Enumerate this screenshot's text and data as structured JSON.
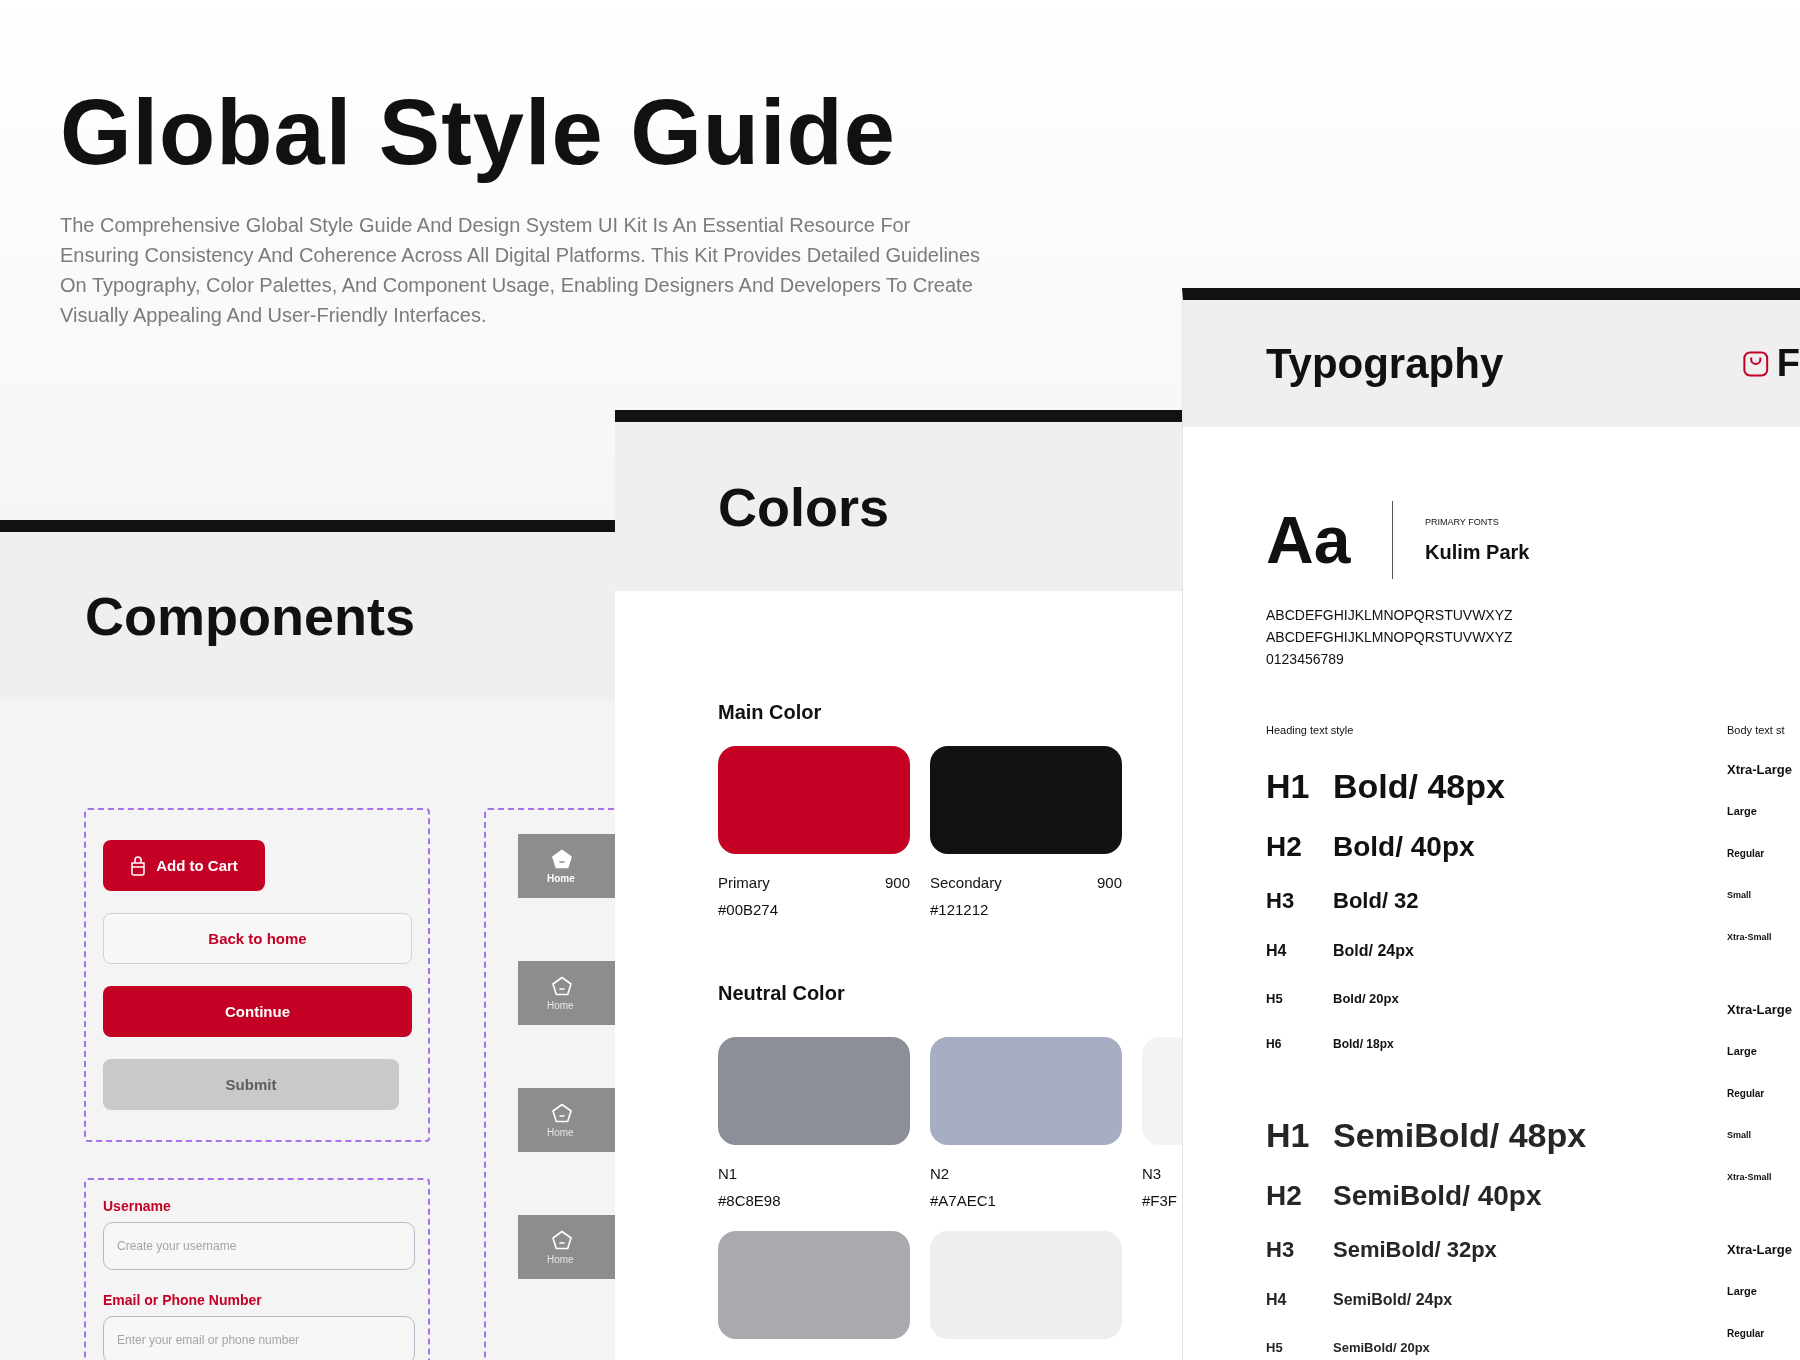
{
  "title": "Global Style Guide",
  "description": "The Comprehensive Global Style Guide And Design System UI Kit Is An Essential Resource For Ensuring Consistency And Coherence Across All Digital Platforms. This Kit Provides Detailed Guidelines On Typography, Color Palettes, And Component Usage, Enabling Designers And Developers To Create Visually Appealing And User-Friendly Interfaces.",
  "components": {
    "title": "Components",
    "buttons": [
      {
        "label": "Add to Cart",
        "kind": "icon-primary"
      },
      {
        "label": "Back to home",
        "kind": "outline"
      },
      {
        "label": "Continue",
        "kind": "primary"
      },
      {
        "label": "Submit",
        "kind": "disabled"
      }
    ],
    "fields": [
      {
        "label": "Username",
        "placeholder": "Create your username"
      },
      {
        "label": "Email or Phone Number",
        "placeholder": "Enter your email or phone number"
      }
    ],
    "nav_tiles": [
      {
        "label": "Home",
        "selected": true
      },
      {
        "label": "Home",
        "selected": false
      },
      {
        "label": "Home",
        "selected": false
      },
      {
        "label": "Home",
        "selected": false
      }
    ]
  },
  "colors": {
    "title": "Colors",
    "main": {
      "heading": "Main Color",
      "swatches": [
        {
          "name": "Primary",
          "weight": "900",
          "hex": "#00B274",
          "color": "#c40024"
        },
        {
          "name": "Secondary",
          "weight": "900",
          "hex": "#121212",
          "color": "#121212"
        }
      ]
    },
    "neutral": {
      "heading": "Neutral Color",
      "swatches": [
        {
          "name": "N1",
          "hex": "#8C8E98",
          "color": "#8c8e98"
        },
        {
          "name": "N2",
          "hex": "#A7AEC1",
          "color": "#a7aec1"
        },
        {
          "name": "N3",
          "hex": "#F3F",
          "color": "#f3f3f3"
        }
      ],
      "more_swatches": [
        {
          "color": "#a9aaad"
        },
        {
          "color": "#eeeeee"
        }
      ]
    }
  },
  "typography": {
    "title": "Typography",
    "brand": "F",
    "sample": "Aa",
    "font_label": "PRIMARY FONTS",
    "font_name": "Kulim Park",
    "alphabet": [
      "ABCDEFGHIJKLMNOPQRSTUVWXYZ",
      "ABCDEFGHIJKLMNOPQRSTUVWXYZ",
      "0123456789"
    ],
    "heading_label": "Heading text style",
    "heading_groups": [
      {
        "kind": "bold",
        "rows": [
          {
            "level": "H1",
            "style": "Bold/ 48px"
          },
          {
            "level": "H2",
            "style": "Bold/ 40px"
          },
          {
            "level": "H3",
            "style": "Bold/ 32"
          },
          {
            "level": "H4",
            "style": "Bold/ 24px"
          },
          {
            "level": "H5",
            "style": "Bold/ 20px"
          },
          {
            "level": "H6",
            "style": "Bold/ 18px"
          }
        ]
      },
      {
        "kind": "semibold",
        "rows": [
          {
            "level": "H1",
            "style": "SemiBold/ 48px"
          },
          {
            "level": "H2",
            "style": "SemiBold/ 40px"
          },
          {
            "level": "H3",
            "style": "SemiBold/ 32px"
          },
          {
            "level": "H4",
            "style": "SemiBold/ 24px"
          },
          {
            "level": "H5",
            "style": "SemiBold/ 20px"
          }
        ]
      }
    ],
    "body_label": "Body text st",
    "body_groups": [
      [
        "Xtra-Large",
        "Large",
        "Regular",
        "Small",
        "Xtra-Small"
      ],
      [
        "Xtra-Large",
        "Large",
        "Regular",
        "Small",
        "Xtra-Small"
      ],
      [
        "Xtra-Large",
        "Large",
        "Regular"
      ]
    ]
  }
}
